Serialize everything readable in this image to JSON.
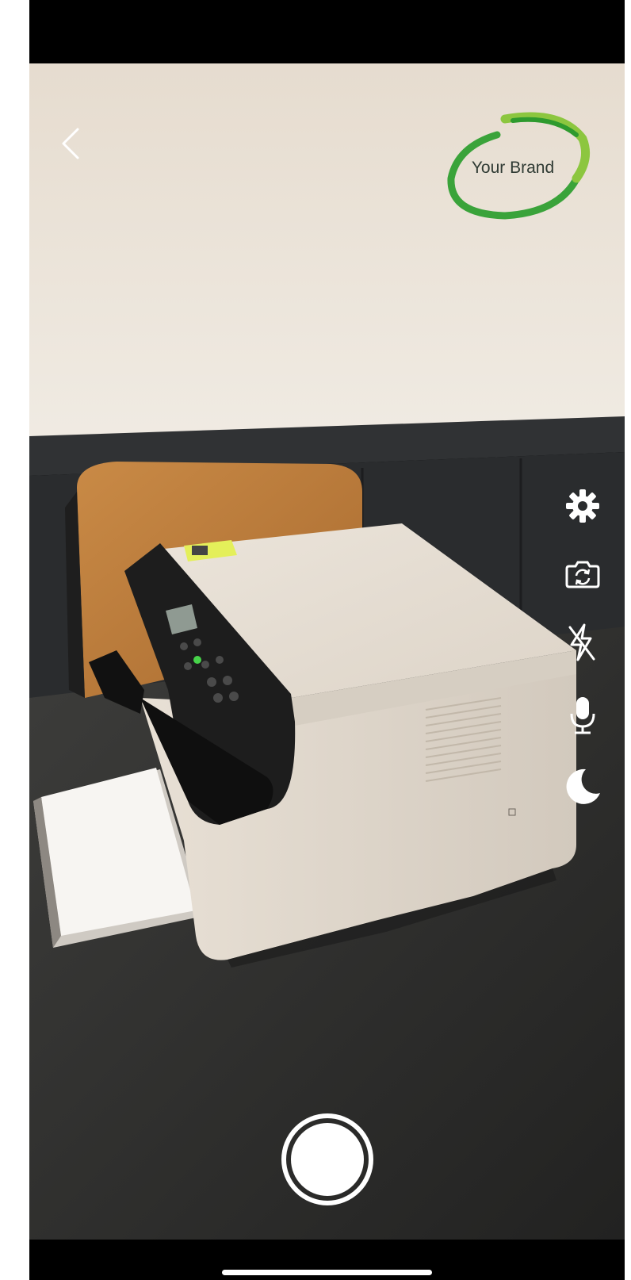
{
  "brand": {
    "text": "Your Brand"
  },
  "icons": {
    "back": "chevron-left-icon",
    "settings": "gear-icon",
    "flip_camera": "camera-flip-icon",
    "flash": "flash-off-icon",
    "microphone": "microphone-icon",
    "night_mode": "moon-icon",
    "shutter": "shutter-icon"
  },
  "colors": {
    "logo_green": "#3aa33a",
    "logo_light_green": "#8cc63f",
    "control_white": "#ffffff",
    "status_bar": "#000000"
  }
}
